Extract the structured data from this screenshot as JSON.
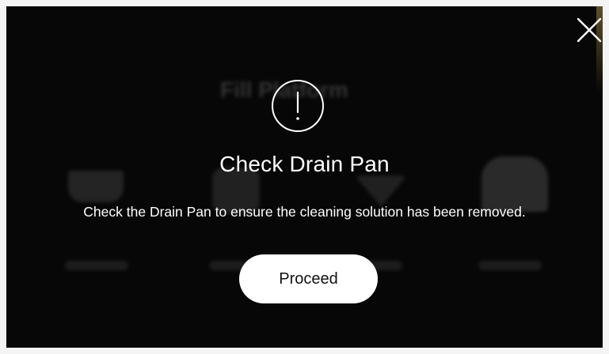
{
  "background_screen": {
    "title": "Fill Platform"
  },
  "modal": {
    "icon": "exclamation-circle-icon",
    "title": "Check Drain Pan",
    "message": "Check the Drain Pan to ensure the cleaning solution has been removed.",
    "proceed_label": "Proceed"
  },
  "header": {
    "close_icon": "close-icon"
  },
  "colors": {
    "background": "#070707",
    "text": "#ffffff",
    "button_bg": "#ffffff",
    "button_text": "#111111"
  }
}
